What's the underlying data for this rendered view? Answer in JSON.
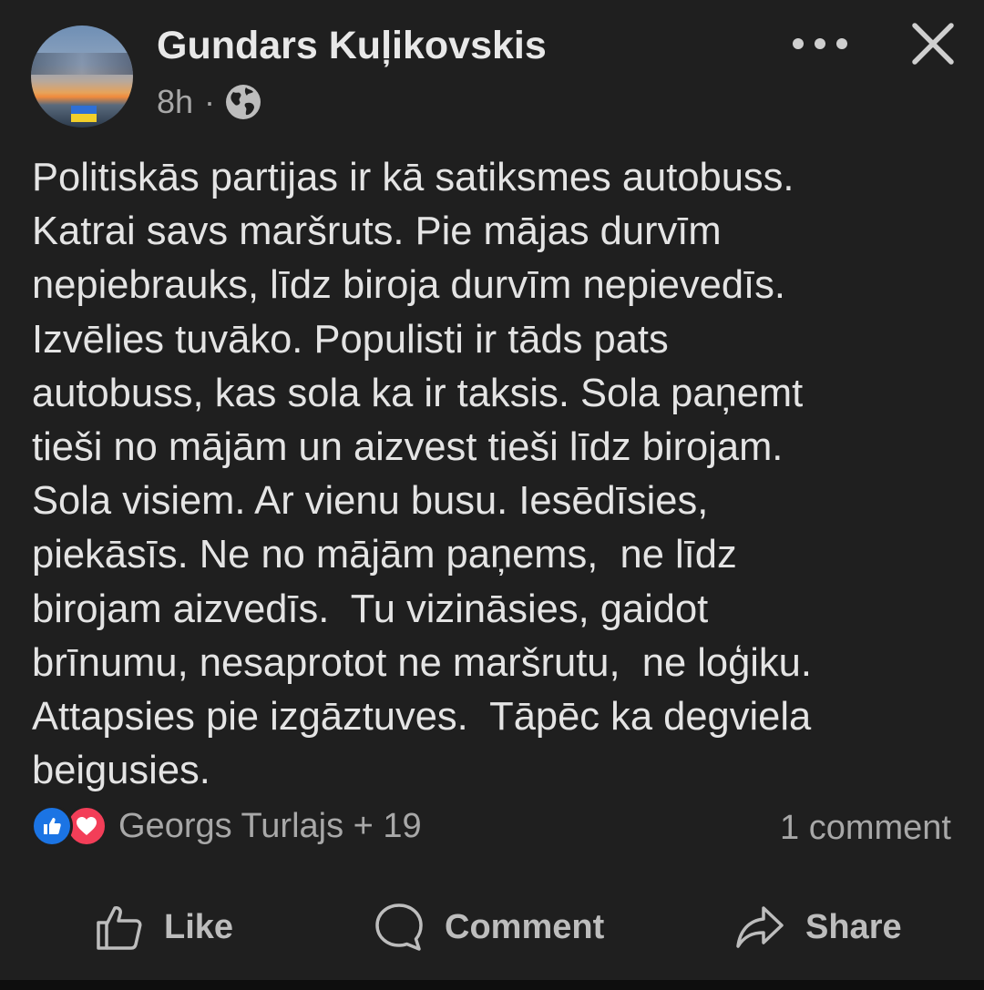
{
  "post": {
    "author": "Gundars Kuļikovskis",
    "time": "8h",
    "separator": "·",
    "privacy_icon": "globe-icon",
    "body_lines": [
      "Politiskās partijas ir kā satiksmes autobuss.",
      "Katrai savs maršruts. Pie mājas durvīm",
      "nepiebrauks, līdz biroja durvīm nepievedīs.",
      "Izvēlies tuvāko. Populisti ir tāds pats",
      "autobuss, kas sola ka ir taksis. Sola paņemt",
      "tieši no mājām un aizvest tieši līdz birojam.",
      "Sola visiem. Ar vienu busu. Iesēdīsies,",
      "piekāsīs. Ne no mājām paņems,  ne līdz",
      "birojam aizvedīs.  Tu vizināsies, gaidot",
      "brīnumu, nesaprotot ne maršrutu,  ne loģiku.",
      "Attapsies pie izgāztuves.  Tāpēc ka degviela",
      "beigusies."
    ]
  },
  "reactions": {
    "icons": [
      "like-reaction-icon",
      "love-reaction-icon"
    ],
    "summary": "Georgs Turlajs + 19"
  },
  "comments": {
    "count_label": "1 comment"
  },
  "actions": {
    "like": "Like",
    "comment": "Comment",
    "share": "Share"
  },
  "colors": {
    "background": "#1f1f1f",
    "text": "#e4e4e4",
    "muted": "#a8a8a8",
    "like_blue": "#1b74e4",
    "love_red": "#f33e58"
  }
}
